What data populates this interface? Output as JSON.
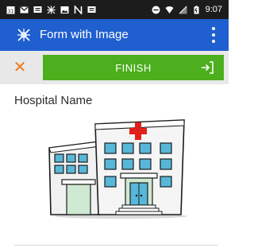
{
  "status_bar": {
    "time": "9:07",
    "left_icons": [
      "calendar-icon",
      "gmail-icon",
      "message-icon",
      "app-icon",
      "gallery-icon",
      "n-icon",
      "message-icon"
    ],
    "right_icons": [
      "do-not-disturb-icon",
      "wifi-icon",
      "signal-icon",
      "battery-icon"
    ]
  },
  "app_bar": {
    "title": "Form with Image",
    "menu_icon": "more-vert-icon",
    "color": "#1f5fcf"
  },
  "actions": {
    "cancel_icon": "close-icon",
    "finish_label": "FINISH",
    "finish_icon": "exit-arrow-icon",
    "finish_color": "#4caf1e",
    "cancel_color": "#ef7a1a"
  },
  "form": {
    "question_label": "Hospital Name",
    "image_icon": "hospital-icon"
  }
}
